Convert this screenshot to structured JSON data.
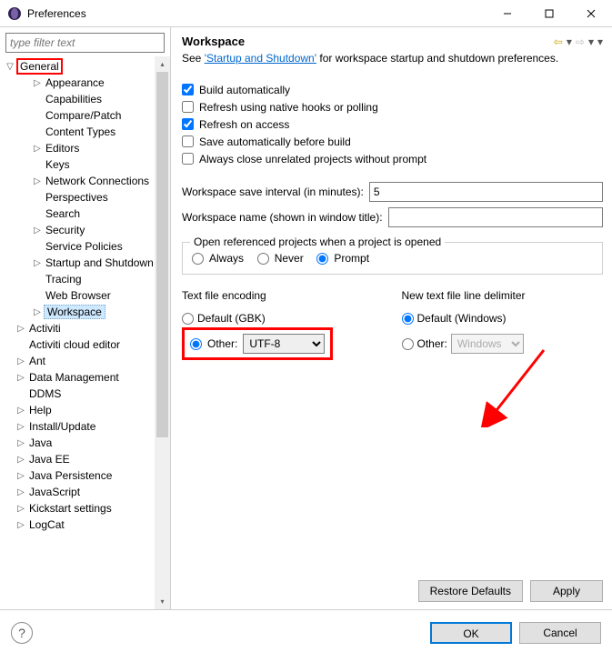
{
  "window": {
    "title": "Preferences"
  },
  "filter": {
    "placeholder": "type filter text"
  },
  "tree": {
    "general": "General",
    "general_children": [
      "Appearance",
      "Capabilities",
      "Compare/Patch",
      "Content Types",
      "Editors",
      "Keys",
      "Network Connections",
      "Perspectives",
      "Search",
      "Security",
      "Service Policies",
      "Startup and Shutdown",
      "Tracing",
      "Web Browser",
      "Workspace"
    ],
    "siblings": [
      "Activiti",
      "Activiti cloud editor",
      "Ant",
      "Data Management",
      "DDMS",
      "Help",
      "Install/Update",
      "Java",
      "Java EE",
      "Java Persistence",
      "JavaScript",
      "Kickstart settings",
      "LogCat"
    ]
  },
  "page": {
    "title": "Workspace",
    "see_prefix": "See ",
    "see_link": "'Startup and Shutdown'",
    "see_suffix": " for workspace startup and shutdown preferences.",
    "checks": {
      "build_auto": "Build automatically",
      "refresh_native": "Refresh using native hooks or polling",
      "refresh_access": "Refresh on access",
      "save_before_build": "Save automatically before build",
      "close_unrelated": "Always close unrelated projects without prompt"
    },
    "save_interval_label": "Workspace save interval (in minutes):",
    "save_interval_value": "5",
    "ws_name_label": "Workspace name (shown in window title):",
    "ws_name_value": "",
    "open_ref_legend": "Open referenced projects when a project is opened",
    "open_ref_options": {
      "always": "Always",
      "never": "Never",
      "prompt": "Prompt"
    },
    "encoding": {
      "legend": "Text file encoding",
      "default": "Default (GBK)",
      "other": "Other:",
      "value": "UTF-8"
    },
    "delimiter": {
      "legend": "New text file line delimiter",
      "default": "Default (Windows)",
      "other": "Other:",
      "value": "Windows"
    },
    "buttons": {
      "restore": "Restore Defaults",
      "apply": "Apply",
      "ok": "OK",
      "cancel": "Cancel"
    }
  }
}
